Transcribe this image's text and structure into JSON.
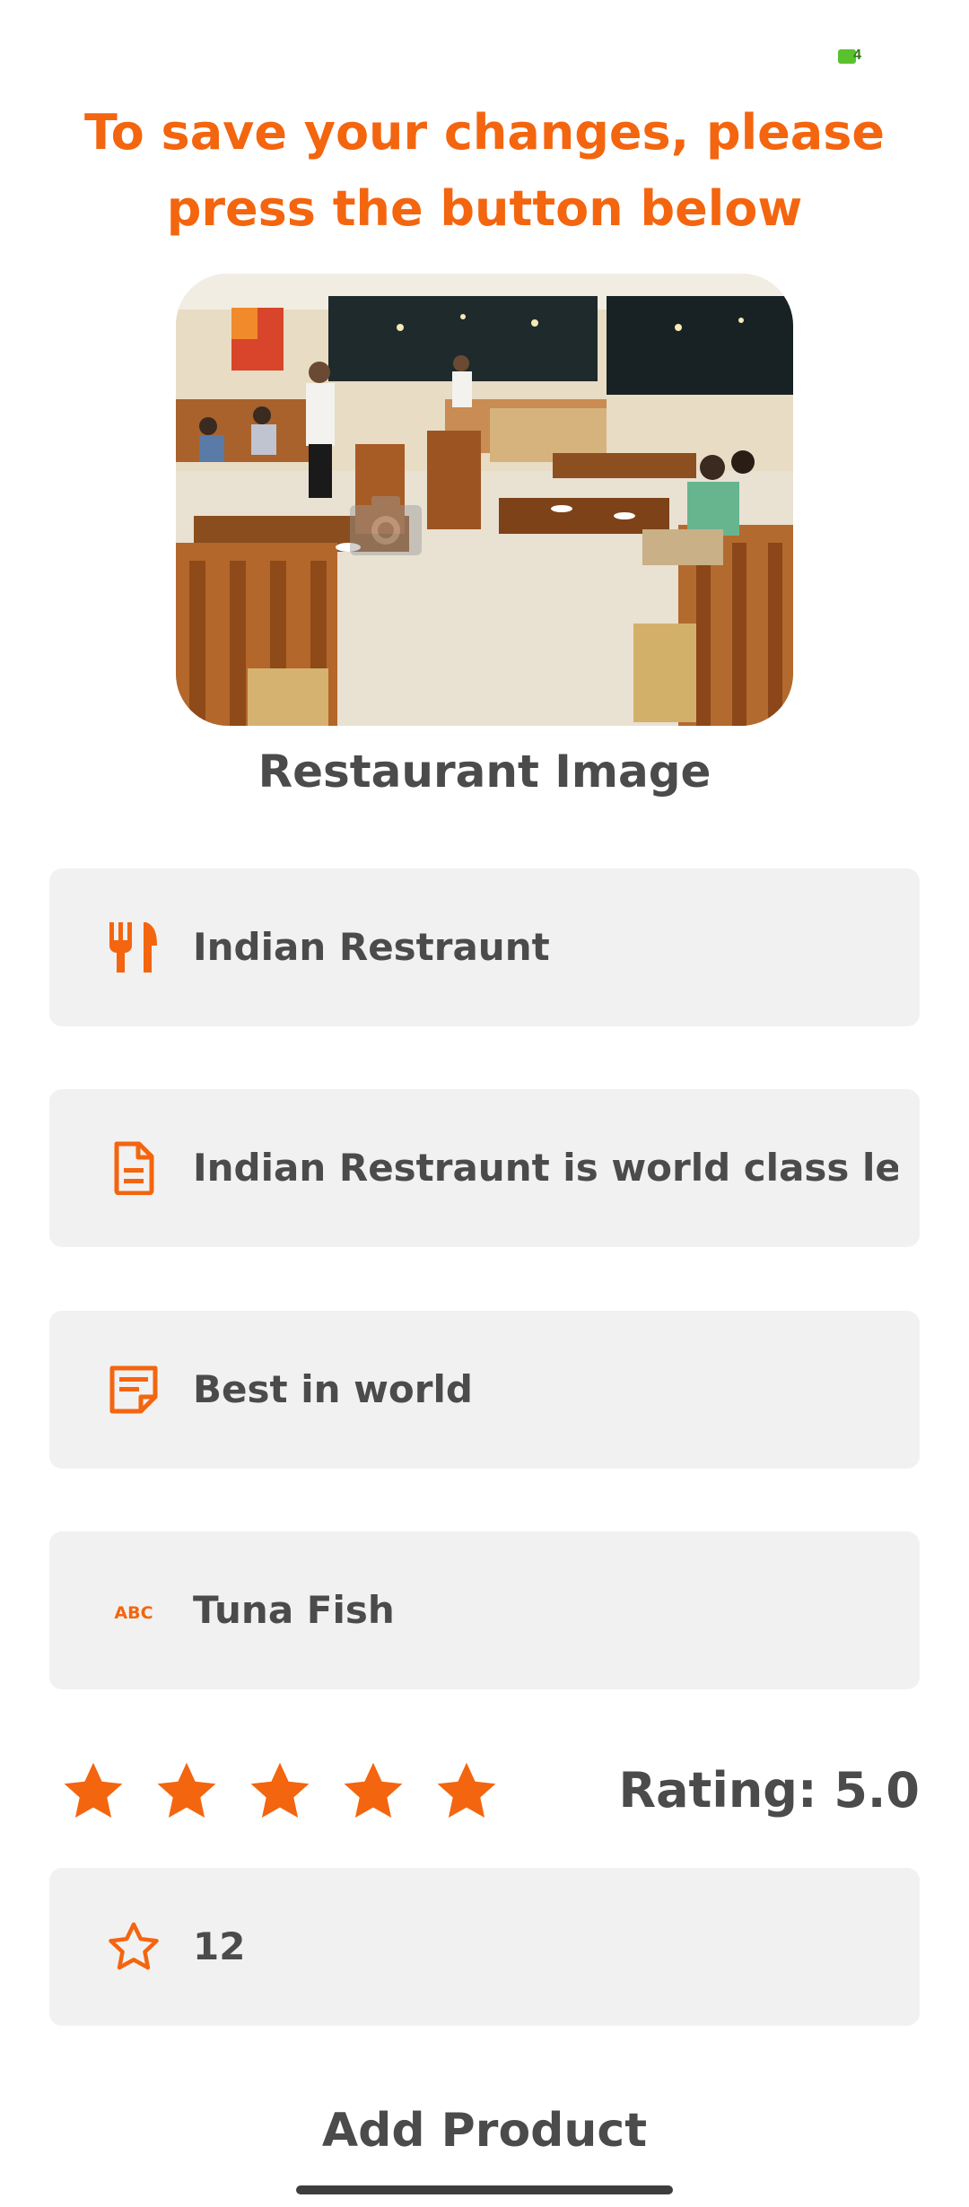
{
  "status_bar": {
    "battery_level": "4",
    "battery_color": "#5ac12f"
  },
  "header": {
    "title": "To save your changes, please press the button below",
    "color": "#f4650f"
  },
  "restaurant_image": {
    "caption": "Restaurant Image",
    "overlay_icon": "camera-icon"
  },
  "fields": [
    {
      "icon": "cutlery-icon",
      "value": "Indian Restraunt"
    },
    {
      "icon": "document-icon",
      "value": "Indian Restraunt is world class lead"
    },
    {
      "icon": "note-icon",
      "value": "Best in world"
    },
    {
      "icon": "abc-icon",
      "value": "Tuna Fish"
    }
  ],
  "rating": {
    "stars_filled": 5,
    "stars_total": 5,
    "label": "Rating: 5.0",
    "star_color": "#f4650f"
  },
  "count_field": {
    "icon": "star-outline-icon",
    "value": "12"
  },
  "footer": {
    "button_label": "Add Product"
  },
  "colors": {
    "accent": "#f4650f",
    "text": "#4b4b4b",
    "field_background": "#f1f1f1"
  }
}
